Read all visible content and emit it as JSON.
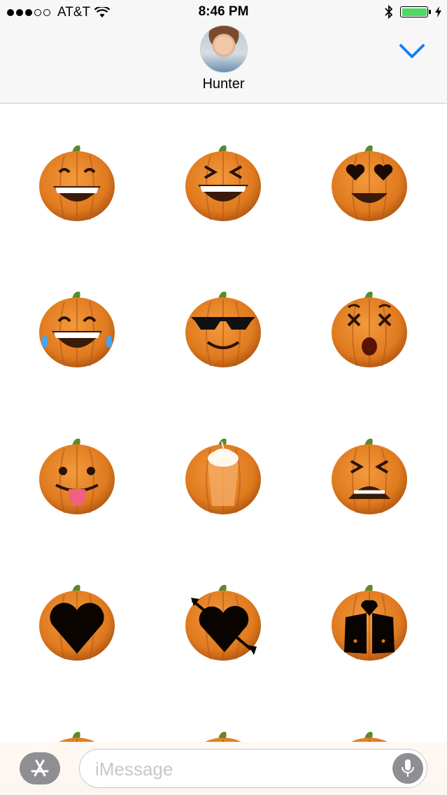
{
  "status_bar": {
    "carrier": "AT&T",
    "time": "8:46 PM",
    "signal_bars_filled": 3,
    "signal_bars_total": 5,
    "battery_level": 1.0,
    "icons": [
      "wifi-icon",
      "bluetooth-icon",
      "battery-icon",
      "charging-bolt-icon"
    ]
  },
  "header": {
    "contact_name": "Hunter",
    "collapse_icon": "chevron-down-icon",
    "accent_color": "#1a7ff5"
  },
  "stickers": [
    {
      "name": "pumpkin-grinning"
    },
    {
      "name": "pumpkin-squinting-laugh"
    },
    {
      "name": "pumpkin-heart-eyes"
    },
    {
      "name": "pumpkin-tears-of-joy"
    },
    {
      "name": "pumpkin-sunglasses"
    },
    {
      "name": "pumpkin-dizzy"
    },
    {
      "name": "pumpkin-tongue-out"
    },
    {
      "name": "pumpkin-spice-latte"
    },
    {
      "name": "pumpkin-tired"
    },
    {
      "name": "pumpkin-heart-carving"
    },
    {
      "name": "pumpkin-heart-arrow-carving"
    },
    {
      "name": "pumpkin-kissing-couple-carving"
    },
    {
      "name": "pumpkin-partial"
    },
    {
      "name": "pumpkin-partial"
    },
    {
      "name": "pumpkin-partial"
    }
  ],
  "composer": {
    "placeholder": "iMessage",
    "app_store_icon": "app-store-icon",
    "mic_icon": "microphone-icon"
  },
  "colors": {
    "pumpkin": "#e07a1f",
    "stem": "#5a8a2a",
    "carving": "#3a1a08"
  }
}
